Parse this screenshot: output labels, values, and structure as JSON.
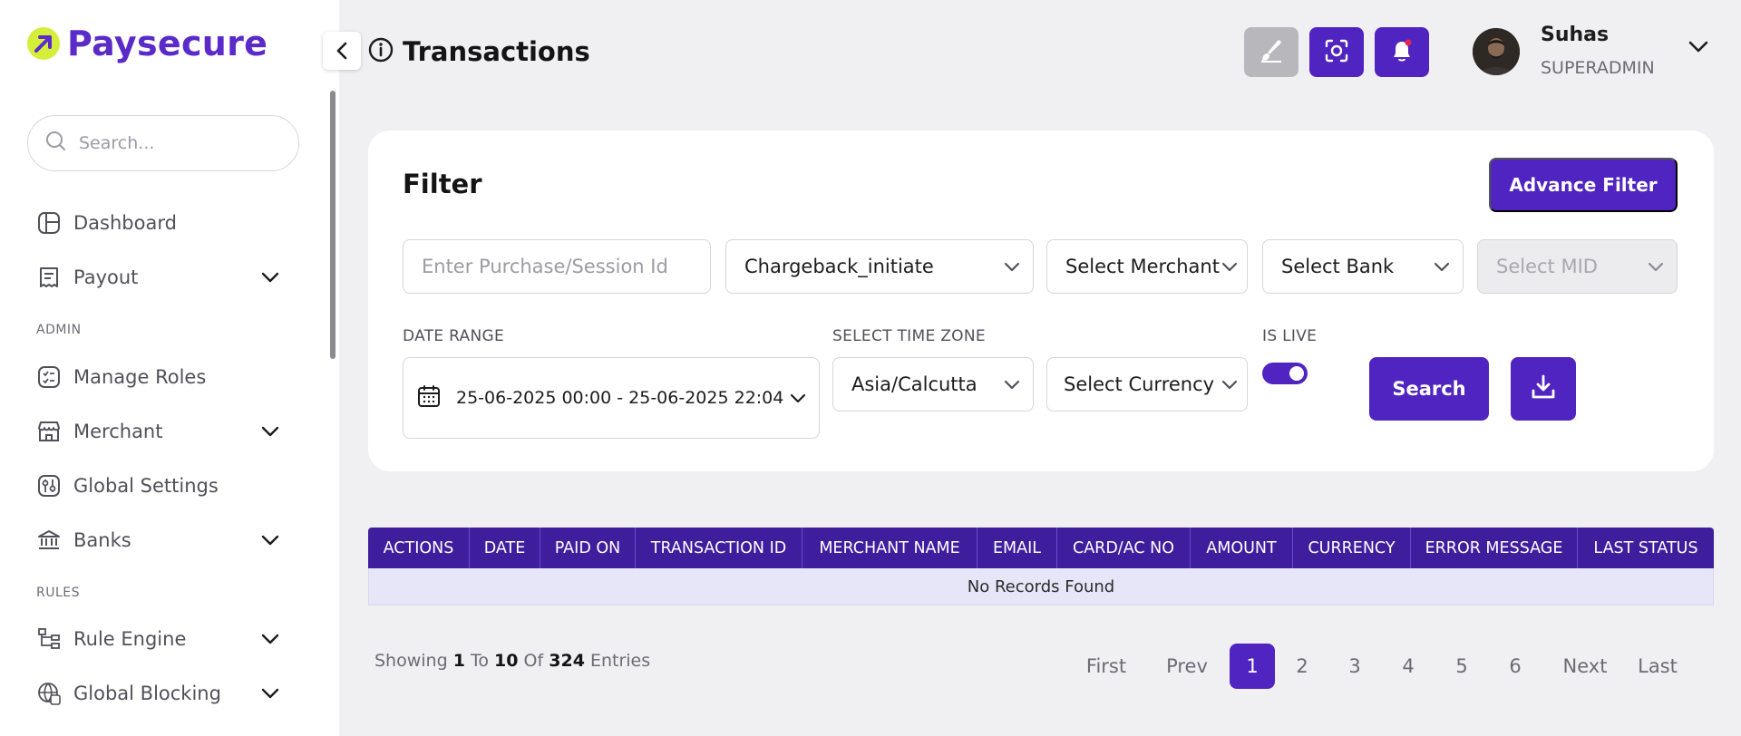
{
  "brand": {
    "name": "Paysecure"
  },
  "sidebar": {
    "search_placeholder": "Search...",
    "items": [
      {
        "label": "Dashboard"
      },
      {
        "label": "Payout"
      },
      {
        "label": "Manage Roles"
      },
      {
        "label": "Merchant"
      },
      {
        "label": "Global Settings"
      },
      {
        "label": "Banks"
      },
      {
        "label": "Rule Engine"
      },
      {
        "label": "Global Blocking"
      }
    ],
    "sections": {
      "admin": "ADMIN",
      "rules": "RULES"
    }
  },
  "header": {
    "title": "Transactions",
    "user": {
      "name": "Suhas",
      "role": "SUPERADMIN"
    }
  },
  "filter": {
    "title": "Filter",
    "advance_label": "Advance Filter",
    "purchase_placeholder": "Enter Purchase/Session Id",
    "status_value": "Chargeback_initiate",
    "merchant_placeholder": "Select Merchant",
    "bank_placeholder": "Select Bank",
    "mid_placeholder": "Select MID",
    "date_range_label": "DATE RANGE",
    "date_range_value": "25-06-2025 00:00 - 25-06-2025 22:04",
    "timezone_label": "SELECT TIME ZONE",
    "timezone_value": "Asia/Calcutta",
    "currency_placeholder": "Select Currency",
    "is_live_label": "IS LIVE",
    "is_live": true,
    "search_label": "Search"
  },
  "table": {
    "columns": [
      "ACTIONS",
      "DATE",
      "PAID ON",
      "TRANSACTION ID",
      "MERCHANT NAME",
      "EMAIL",
      "CARD/AC NO",
      "AMOUNT",
      "CURRENCY",
      "ERROR MESSAGE",
      "LAST STATUS"
    ],
    "empty_text": "No Records Found"
  },
  "pagination": {
    "showing_prefix": "Showing",
    "from": "1",
    "to_word": "To",
    "to": "10",
    "of_word": "Of",
    "total": "324",
    "suffix": "Entries",
    "first": "First",
    "prev": "Prev",
    "pages": [
      "1",
      "2",
      "3",
      "4",
      "5",
      "6"
    ],
    "current": "1",
    "next": "Next",
    "last": "Last"
  },
  "colors": {
    "primary": "#4f24c0",
    "table_header": "#3f1e9e",
    "logo_mark": "#d5ee3a",
    "disabled_button": "#b8b8bc"
  },
  "icons": {
    "theme": "brush-icon",
    "screenshot": "scan-icon",
    "notifications": "bell-icon",
    "download": "download-icon",
    "calendar": "calendar-icon",
    "info": "info-icon"
  }
}
